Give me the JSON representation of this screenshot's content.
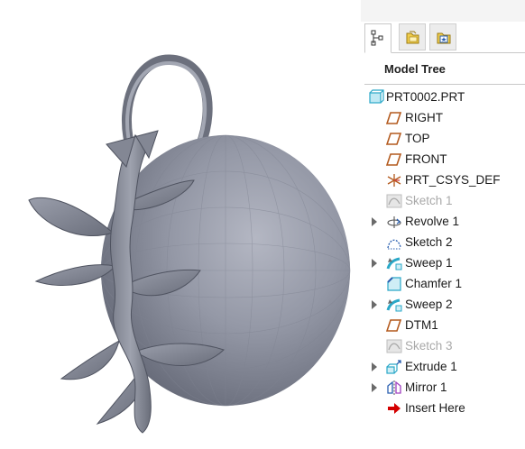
{
  "tabs": [
    {
      "name": "model-tree-tab",
      "icon": "tree-icon",
      "active": true
    },
    {
      "name": "folder-browser-tab",
      "icon": "folder-icon",
      "active": false
    },
    {
      "name": "favorites-tab",
      "icon": "favorites-folder-icon",
      "active": false
    }
  ],
  "model_tree": {
    "title": "Model Tree",
    "items": [
      {
        "label": "PRT0002.PRT",
        "icon": "part-icon",
        "expander": false,
        "suppressed": false,
        "level": 0
      },
      {
        "label": "RIGHT",
        "icon": "datum-plane-icon",
        "expander": false,
        "suppressed": false,
        "level": 1
      },
      {
        "label": "TOP",
        "icon": "datum-plane-icon",
        "expander": false,
        "suppressed": false,
        "level": 1
      },
      {
        "label": "FRONT",
        "icon": "datum-plane-icon",
        "expander": false,
        "suppressed": false,
        "level": 1
      },
      {
        "label": "PRT_CSYS_DEF",
        "icon": "coordinate-system-icon",
        "expander": false,
        "suppressed": false,
        "level": 1
      },
      {
        "label": "Sketch 1",
        "icon": "sketch-icon",
        "expander": false,
        "suppressed": true,
        "level": 1
      },
      {
        "label": "Revolve 1",
        "icon": "revolve-icon",
        "expander": true,
        "suppressed": false,
        "level": 1
      },
      {
        "label": "Sketch 2",
        "icon": "sketch-icon",
        "expander": false,
        "suppressed": false,
        "level": 1
      },
      {
        "label": "Sweep 1",
        "icon": "sweep-icon",
        "expander": true,
        "suppressed": false,
        "level": 1
      },
      {
        "label": "Chamfer 1",
        "icon": "chamfer-icon",
        "expander": false,
        "suppressed": false,
        "level": 1
      },
      {
        "label": "Sweep 2",
        "icon": "sweep-icon",
        "expander": true,
        "suppressed": false,
        "level": 1
      },
      {
        "label": "DTM1",
        "icon": "datum-plane-icon",
        "expander": false,
        "suppressed": false,
        "level": 1
      },
      {
        "label": "Sketch 3",
        "icon": "sketch-icon",
        "expander": false,
        "suppressed": true,
        "level": 1
      },
      {
        "label": "Extrude 1",
        "icon": "extrude-icon",
        "expander": true,
        "suppressed": false,
        "level": 1
      },
      {
        "label": "Mirror 1",
        "icon": "mirror-icon",
        "expander": true,
        "suppressed": false,
        "level": 1
      },
      {
        "label": "Insert Here",
        "icon": "insert-arrow-icon",
        "expander": false,
        "suppressed": false,
        "level": 1
      }
    ]
  },
  "colors": {
    "model_fill": "#8a8e9c",
    "model_shadow": "#5b5f6c",
    "datum_plane": "#b45a1e",
    "insert_arrow": "#d40000",
    "part_icon": "#2aa8c8"
  }
}
